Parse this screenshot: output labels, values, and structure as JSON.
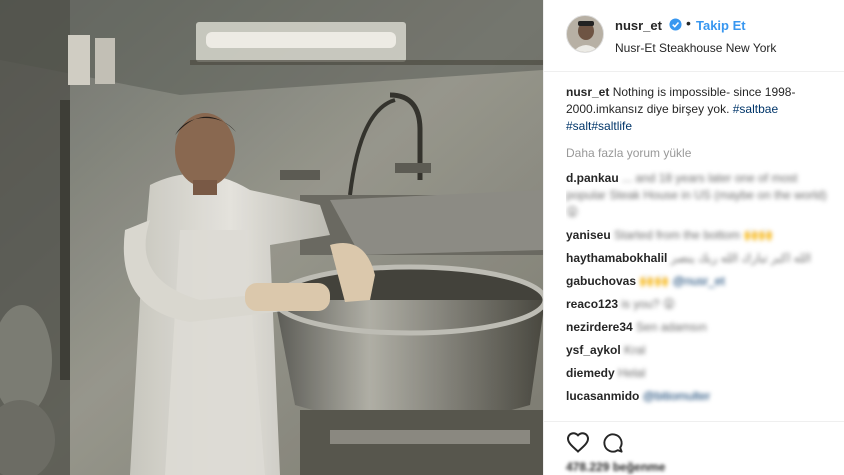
{
  "post": {
    "username": "nusr_et",
    "verified_icon": "verified-badge-icon",
    "separator": "•",
    "follow_label": "Takip Et",
    "location": "Nusr-Et Steakhouse New York",
    "caption": {
      "username": "nusr_et",
      "text": "Nothing is impossible- since 1998-2000.imkansız diye birşey yok.",
      "hashtags": [
        "#saltbae",
        "#salt",
        "#saltlife"
      ]
    },
    "load_more_label": "Daha fazla yorum yükle",
    "comments": [
      {
        "user": "d.pankau",
        "text": "... and 18 years later one of most popular Steak House in US (maybe on the world) 😮"
      },
      {
        "user": "yaniseu",
        "text": "Started from the bottom 🙌🙌"
      },
      {
        "user": "haythamabokhalil",
        "text": "الله اكبر تبارك الله ربك ينصر"
      },
      {
        "user": "gabuchovas",
        "text": "🙌🙌 @nusr_et"
      },
      {
        "user": "reaco123",
        "text": "is you? 😮"
      },
      {
        "user": "nezirdere34",
        "text": "Sen adamsın"
      },
      {
        "user": "ysf_aykol",
        "text": "Kral"
      },
      {
        "user": "diemedy",
        "text": "Helal"
      },
      {
        "user": "lucasanmido",
        "text": "@bitiomulter"
      }
    ],
    "actions": {
      "like_icon": "heart-icon",
      "comment_icon": "comment-bubble-icon"
    },
    "likes_text": "478.229 beğenme"
  },
  "colors": {
    "link_blue": "#3897f0",
    "hashtag": "#003569",
    "muted": "#999999",
    "text": "#262626"
  }
}
